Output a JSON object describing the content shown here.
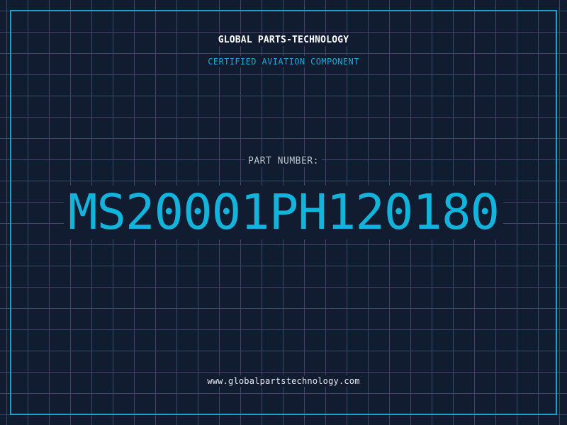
{
  "header": {
    "company": "GLOBAL PARTS-TECHNOLOGY",
    "subtitle": "CERTIFIED AVIATION COMPONENT"
  },
  "part": {
    "label": "PART NUMBER:",
    "number": "MS20001PH120180"
  },
  "footer": {
    "website": "www.globalpartstechnology.com"
  },
  "colors": {
    "background": "#121c30",
    "grid": "#24536c",
    "frame": "#1d9fca",
    "accent": "#12b4dc",
    "subtitle": "#1fa8d3",
    "label": "#b9c3cf",
    "title": "#ffffff"
  }
}
